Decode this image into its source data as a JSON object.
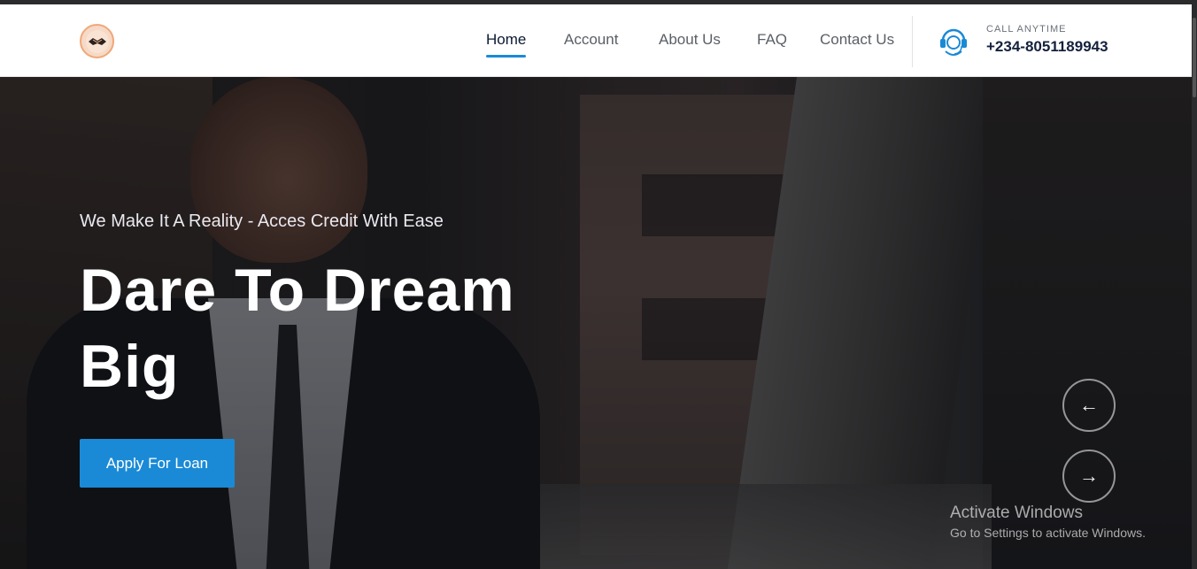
{
  "nav": {
    "items": [
      {
        "label": "Home"
      },
      {
        "label": "Account"
      },
      {
        "label": "About Us"
      },
      {
        "label": "FAQ"
      },
      {
        "label": "Contact Us"
      }
    ],
    "active": "Home"
  },
  "contact": {
    "label": "CALL ANYTIME",
    "phone": "+234-8051189943"
  },
  "hero": {
    "tagline": "We Make It A Reality - Acces Credit With Ease",
    "headline": "Dare To Dream Big",
    "cta_label": "Apply For Loan"
  },
  "slider": {
    "prev_glyph": "←",
    "next_glyph": "→"
  },
  "watermark": {
    "title": "Activate Windows",
    "subtitle": "Go to Settings to activate Windows."
  },
  "colors": {
    "accent": "#1a8ad6",
    "nav_text": "#5a5f66",
    "heading": "#ffffff"
  }
}
